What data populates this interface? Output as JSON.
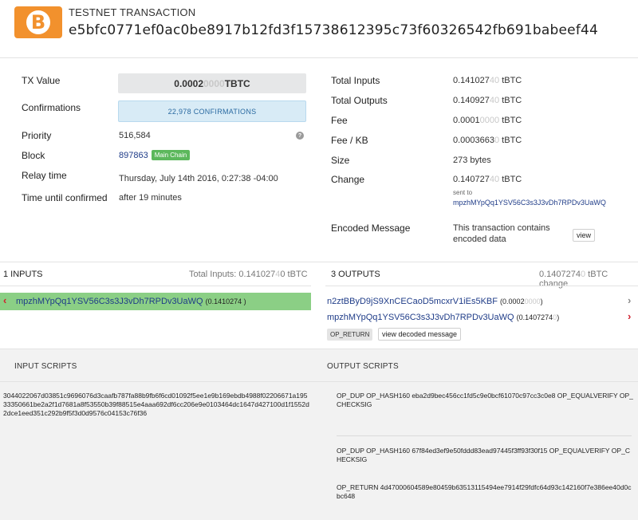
{
  "header": {
    "type_label": "TESTNET TRANSACTION",
    "hash": "e5bfc0771ef0ac0be8917b12fd3f15738612395c73f60326542fb691babeef44",
    "logo_glyph": "B"
  },
  "left": {
    "tx_value_label": "TX Value",
    "tx_value_main": "0.0002",
    "tx_value_faded": "0000",
    "tx_value_unit": " TBTC",
    "confirmations_label": "Confirmations",
    "confirmations_value": "22,978 CONFIRMATIONS",
    "priority_label": "Priority",
    "priority_value": "516,584",
    "help_glyph": "?",
    "block_label": "Block",
    "block_value": "897863",
    "block_badge": "Main Chain",
    "relay_label": "Relay time",
    "relay_value": "Thursday, July 14th 2016, 0:27:38 -04:00",
    "until_label": "Time until confirmed",
    "until_value": "after 19 minutes"
  },
  "right": {
    "total_inputs_label": "Total Inputs",
    "total_inputs_main": "0.141027",
    "total_inputs_faded": "4",
    "total_inputs_tail": "0",
    "total_outputs_label": "Total Outputs",
    "total_outputs_main": "0.140927",
    "total_outputs_faded": "4",
    "total_outputs_tail": "0",
    "fee_label": "Fee",
    "fee_main": "0.0001",
    "fee_faded": "0000",
    "fee_kb_label": "Fee / KB",
    "fee_kb_main": "0.0003663",
    "fee_kb_faded": "0",
    "size_label": "Size",
    "size_value": "273 bytes",
    "change_label": "Change",
    "change_main": "0.140727",
    "change_faded": "4",
    "change_tail": "0",
    "sent_to_label": "sent to",
    "sent_to_address": "mpzhMYpQq1YSV56C3s3J3vDh7RPDv3UaWQ",
    "encoded_label": "Encoded Message",
    "encoded_value": "This transaction contains encoded data",
    "view_button": "view",
    "unit": " tBTC"
  },
  "inputs": {
    "header": "1 INPUTS",
    "total_text": "Total Inputs: 0.141027",
    "total_faded": "4",
    "total_tail": "0 tBTC",
    "arrow": "‹",
    "address": "mpzhMYpQq1YSV56C3s3J3vDh7RPDv3UaWQ",
    "amount": "(0.1410274",
    "amount_close": " )"
  },
  "outputs": {
    "header": "3 OUTPUTS",
    "total_main": "0.1407274",
    "total_faded": "0",
    "total_tail": " tBTC change",
    "items": [
      {
        "address": "n2ztBByD9jS9XnCECaoD5mcxrV1iEs5KBF",
        "amount_main": "(0.0002",
        "amount_faded": "0000",
        "amount_close": ")",
        "arrow": "›"
      },
      {
        "address": "mpzhMYpQq1YSV56C3s3J3vDh7RPDv3UaWQ",
        "amount_main": "(0.1407274",
        "amount_faded": "0",
        "amount_close": ")",
        "arrow": "›"
      }
    ],
    "op_return_tag": "OP_RETURN",
    "view_decoded_button": "view decoded message"
  },
  "scripts": {
    "input_header": "INPUT SCRIPTS",
    "output_header": "OUTPUT SCRIPTS",
    "input_script": "3044022067d03851c9696076d3caafb787fa88b9fb6f6cd01092f5ee1e9b169ebdb4988f02206671a19533350661be2a2f1d7681a8f53550b39f88515e4aaa692df6cc206e9e0103464dc1647d427100d1f1552d2dce1eed351c292b9f5f3d0d9576c04153c76f36",
    "output_scripts": [
      "OP_DUP OP_HASH160 eba2d9bec456cc1fd5c9e0bcf61070c97cc3c0e8 OP_EQUALVERIFY OP_CHECKSIG",
      "OP_DUP OP_HASH160 67f84ed3ef9e50fddd83ead97445f3ff93f30f15 OP_EQUALVERIFY OP_CHECKSIG",
      "OP_RETURN 4d47000604589e80459b63513115494ee7914f29fdfc64d93c142160f7e386ee40d0cbc648"
    ]
  },
  "colors": {
    "brand": "#f2912d",
    "link": "#1f3c88",
    "input_highlight": "#8bcf85",
    "badge_green": "#5cb85c",
    "arrow_red": "#d0202e"
  }
}
